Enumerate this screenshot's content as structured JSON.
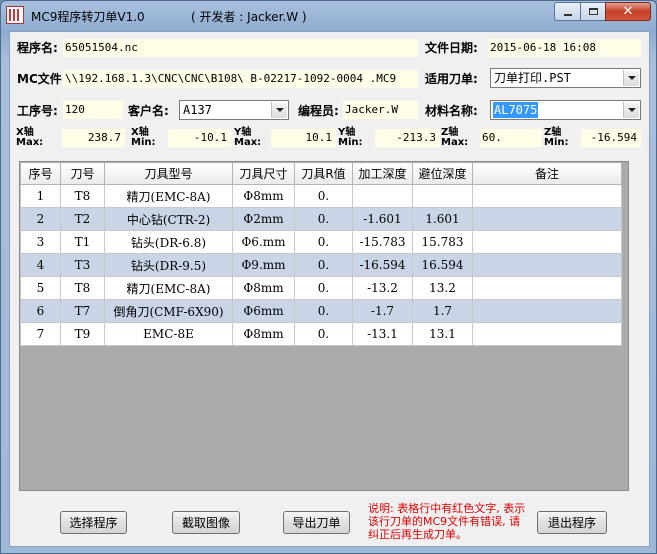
{
  "window": {
    "title": "MC9程序转刀单V1.0",
    "developer": "( 开发者 : Jacker.W )"
  },
  "form": {
    "program_name_label": "程序名:",
    "program_name": "65051504.nc",
    "file_date_label": "文件日期:",
    "file_date": "2015-06-18 16:08",
    "mc_file_label": "MC文件:",
    "mc_file": "\\\\192.168.1.3\\CNC\\CNC\\B108\\ B-02217-1092-0004 .MC9",
    "tool_sheet_label": "适用刀单:",
    "tool_sheet": "刀单打印.PST",
    "process_no_label": "工序号:",
    "process_no": "120",
    "customer_label": "客户名:",
    "customer": "A137",
    "programmer_label": "编程员:",
    "programmer": "Jacker.W",
    "material_label": "材料名称:",
    "material": "AL7075"
  },
  "axes": [
    {
      "label1": "X轴",
      "label2": "Max:",
      "value": "238.7"
    },
    {
      "label1": "X轴",
      "label2": "Min:",
      "value": "-10.1"
    },
    {
      "label1": "Y轴",
      "label2": "Max:",
      "value": "10.1"
    },
    {
      "label1": "Y轴",
      "label2": "Min:",
      "value": "-213.3"
    },
    {
      "label1": "Z轴",
      "label2": "Max:",
      "value": "60."
    },
    {
      "label1": "Z轴",
      "label2": "Min:",
      "value": "-16.594"
    }
  ],
  "table": {
    "headers": [
      "序号",
      "刀号",
      "刀具型号",
      "刀具尺寸",
      "刀具R值",
      "加工深度",
      "避位深度",
      "备注"
    ],
    "rows": [
      [
        "1",
        "T8",
        "精刀(EMC-8A)",
        "Φ8mm",
        "0.",
        "",
        "",
        ""
      ],
      [
        "2",
        "T2",
        "中心钻(CTR-2)",
        "Φ2mm",
        "0.",
        "-1.601",
        "1.601",
        ""
      ],
      [
        "3",
        "T1",
        "钻头(DR-6.8)",
        "Φ6.mm",
        "0.",
        "-15.783",
        "15.783",
        ""
      ],
      [
        "4",
        "T3",
        "钻头(DR-9.5)",
        "Φ9.mm",
        "0.",
        "-16.594",
        "16.594",
        ""
      ],
      [
        "5",
        "T8",
        "精刀(EMC-8A)",
        "Φ8mm",
        "0.",
        "-13.2",
        "13.2",
        ""
      ],
      [
        "6",
        "T7",
        "倒角刀(CMF-6X90)",
        "Φ6mm",
        "0.",
        "-1.7",
        "1.7",
        ""
      ],
      [
        "7",
        "T9",
        "EMC-8E",
        "Φ8mm",
        "0.",
        "-13.1",
        "13.1",
        ""
      ]
    ]
  },
  "buttons": {
    "select_program": "选择程序",
    "capture_image": "截取图像",
    "export_sheet": "导出刀单",
    "exit_program": "退出程序"
  },
  "note": "说明: 表格行中有红色文字, 表示该行刀单的MC9文件有错误, 请纠正后再生成刀单。",
  "colors": {
    "note_red": "#e00000",
    "alt_row": "#c9d5e6",
    "field_bg": "#fffde7",
    "selection": "#3399ff"
  }
}
